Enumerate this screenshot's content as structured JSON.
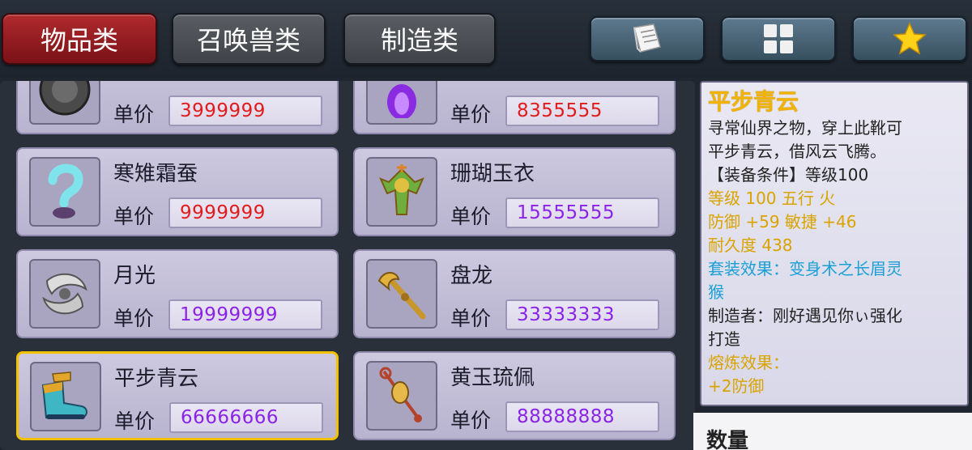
{
  "tabs": [
    {
      "label": "物品类",
      "active": true
    },
    {
      "label": "召唤兽类",
      "active": false
    },
    {
      "label": "制造类",
      "active": false
    }
  ],
  "icon_buttons": [
    "notebook-icon",
    "grid-icon",
    "star-icon"
  ],
  "price_label": "单价",
  "items": [
    {
      "name": "",
      "price": "3999999",
      "price_color": "#e21b1b",
      "icon": "coin-icon"
    },
    {
      "name": "",
      "price": "8355555",
      "price_color": "#e21b1b",
      "icon": "purple-flame-icon"
    },
    {
      "name": "寒雉霜蚕",
      "price": "9999999",
      "price_color": "#e21b1b",
      "icon": "silkworm-icon"
    },
    {
      "name": "珊瑚玉衣",
      "price": "15555555",
      "price_color": "#8b23e6",
      "icon": "coral-robe-icon"
    },
    {
      "name": "月光",
      "price": "19999999",
      "price_color": "#8b23e6",
      "icon": "moon-blade-icon"
    },
    {
      "name": "盘龙",
      "price": "33333333",
      "price_color": "#8b23e6",
      "icon": "dragon-staff-icon"
    },
    {
      "name": "平步青云",
      "price": "66666666",
      "price_color": "#8b23e6",
      "icon": "boots-icon",
      "selected": true
    },
    {
      "name": "黄玉琉佩",
      "price": "88888888",
      "price_color": "#8b23e6",
      "icon": "jade-pendant-icon"
    }
  ],
  "detail": {
    "title": "平步青云",
    "desc_1": "寻常仙界之物，穿上此靴可",
    "desc_2": "平步青云，借风云飞腾。",
    "requirement": "【装备条件】等级100",
    "level_line": "等级 100  五行 火",
    "stats_line": "防御 +59 敏捷 +46",
    "durability": "耐久度 438",
    "set_1": "套装效果：变身术之长眉灵",
    "set_2": "猴",
    "maker_1": "制造者：刚好遇见你ぃ强化",
    "maker_2": "打造",
    "smelt": "熔炼效果：",
    "smelt_cut": "+2防御"
  },
  "quantity_label": "数量"
}
